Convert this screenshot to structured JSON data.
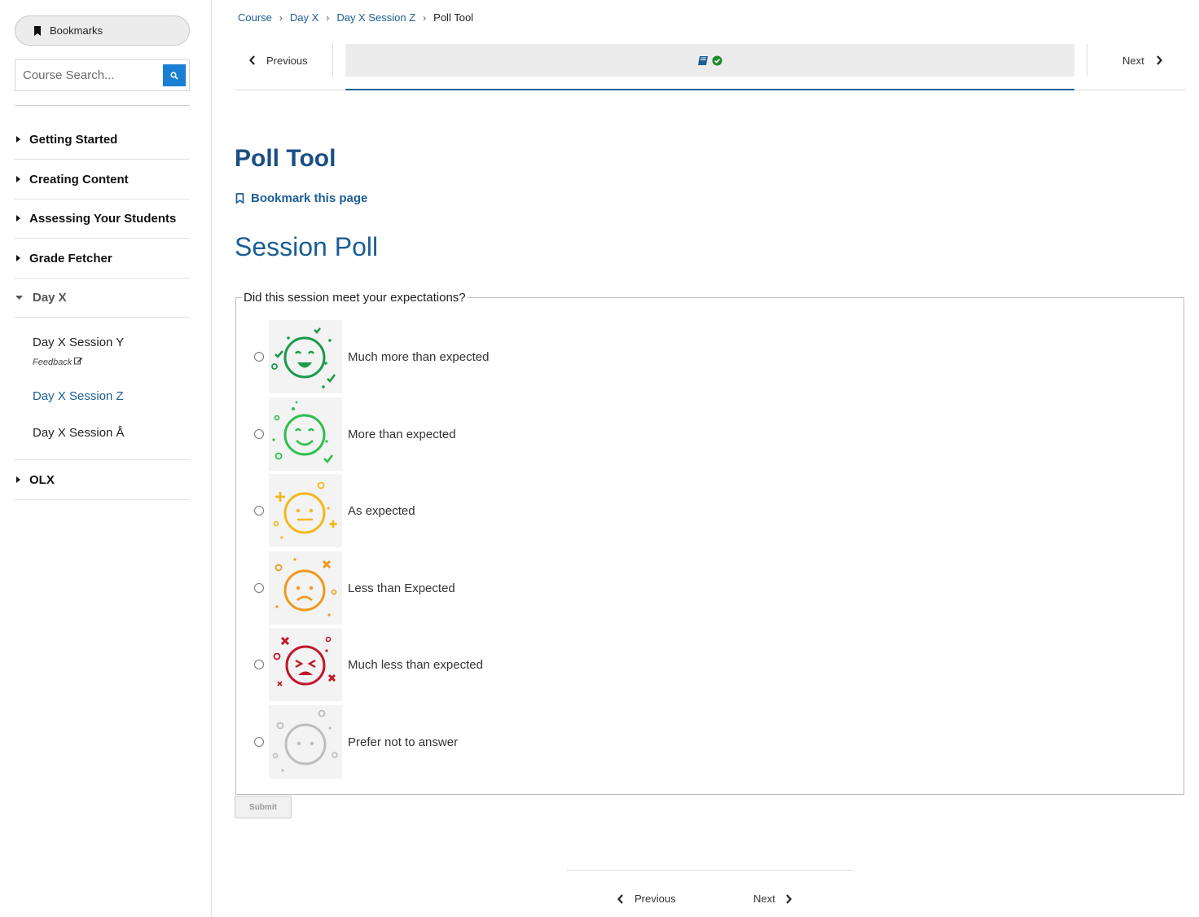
{
  "sidebar": {
    "bookmarks_label": "Bookmarks",
    "search_placeholder": "Course Search...",
    "sections": [
      {
        "label": "Getting Started"
      },
      {
        "label": "Creating Content"
      },
      {
        "label": "Assessing Your Students"
      },
      {
        "label": "Grade Fetcher"
      },
      {
        "label": "Day X"
      },
      {
        "label": "OLX"
      }
    ],
    "day_x_items": [
      {
        "label": "Day X Session Y",
        "note": "Feedback"
      },
      {
        "label": "Day X Session Z"
      },
      {
        "label": "Day X Session Å"
      }
    ]
  },
  "breadcrumb": [
    "Course",
    "Day X",
    "Day X Session Z",
    "Poll Tool"
  ],
  "sequence_nav": {
    "previous": "Previous",
    "next": "Next"
  },
  "main": {
    "title": "Poll Tool",
    "bookmark_link": "Bookmark this page",
    "section_title": "Session Poll",
    "question": "Did this session meet your expectations?",
    "options": [
      {
        "label": "Much more than expected",
        "face": "very-happy-face-icon",
        "color": "#1a9a4a"
      },
      {
        "label": "More than expected",
        "face": "happy-face-icon",
        "color": "#2fbf4f"
      },
      {
        "label": "As expected",
        "face": "neutral-face-icon",
        "color": "#f2b81c"
      },
      {
        "label": "Less than Expected",
        "face": "sad-face-icon",
        "color": "#ee9a1e"
      },
      {
        "label": "Much less than expected",
        "face": "angry-face-icon",
        "color": "#c0182c"
      },
      {
        "label": "Prefer not to answer",
        "face": "blank-face-icon",
        "color": "#bdbdbd"
      }
    ],
    "submit": "Submit"
  },
  "bottom_nav": {
    "previous": "Previous",
    "next": "Next"
  },
  "colors": {
    "link": "#1b5e95",
    "title": "#1b4f84",
    "search_button": "#1a7fd4",
    "complete_check": "#1e8a2e"
  }
}
